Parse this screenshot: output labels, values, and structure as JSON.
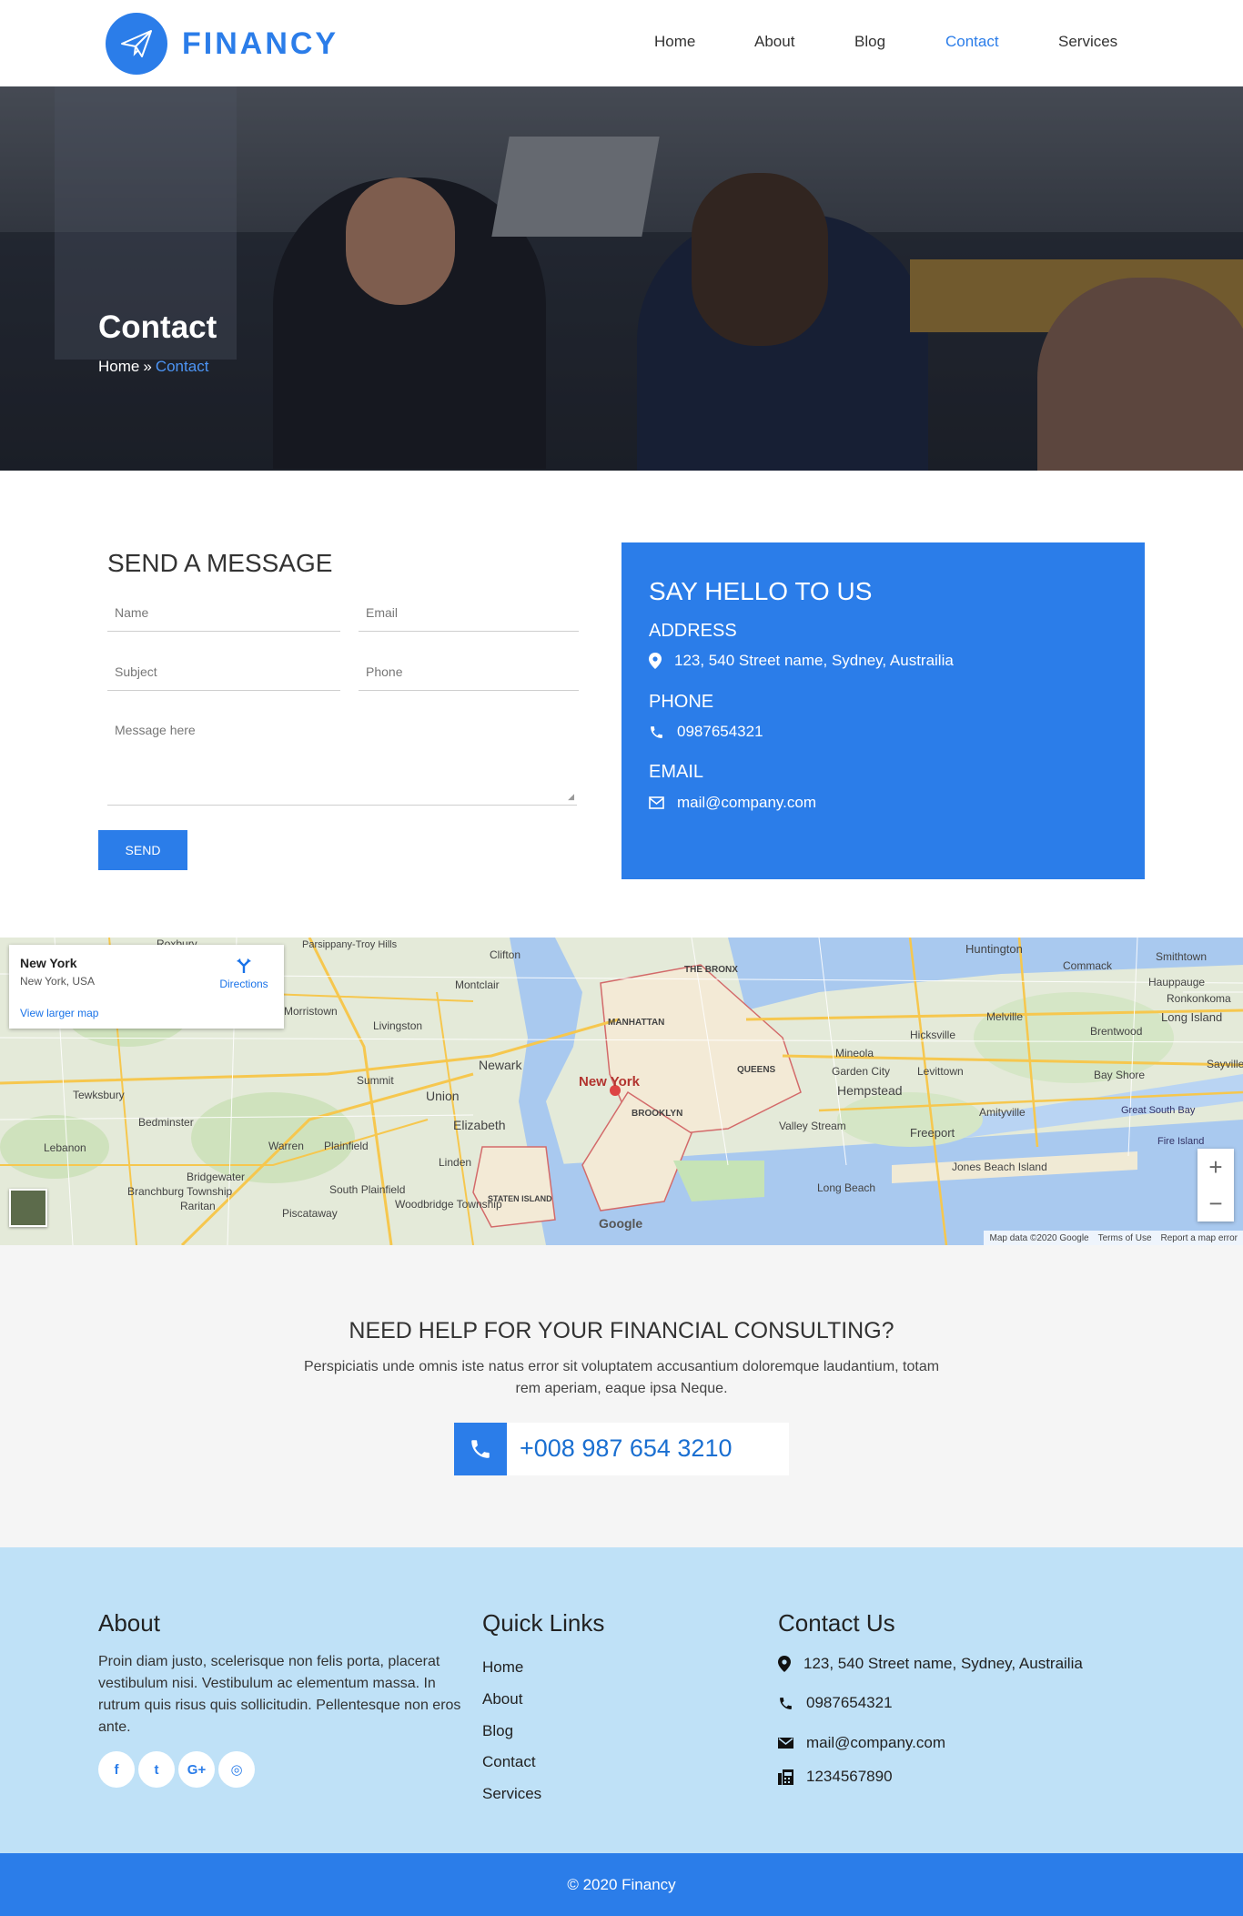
{
  "header": {
    "brand": "FINANCY",
    "nav": [
      {
        "label": "Home"
      },
      {
        "label": "About"
      },
      {
        "label": "Blog"
      },
      {
        "label": "Contact",
        "active": true
      },
      {
        "label": "Services"
      }
    ]
  },
  "hero": {
    "title": "Contact",
    "breadcrumb": {
      "home": "Home",
      "separator": "»",
      "current": "Contact"
    }
  },
  "form": {
    "title": "SEND A MESSAGE",
    "name_placeholder": "Name",
    "email_placeholder": "Email",
    "subject_placeholder": "Subject",
    "phone_placeholder": "Phone",
    "message_placeholder": "Message here",
    "submit_label": "SEND"
  },
  "hello": {
    "title": "SAY HELLO TO US",
    "address_label": "ADDRESS",
    "address": "123, 540 Street name, Sydney, Austrailia",
    "phone_label": "PHONE",
    "phone": "0987654321",
    "email_label": "EMAIL",
    "email": "mail@company.com"
  },
  "map": {
    "place_name": "New York",
    "place_sub": "New York, USA",
    "directions": "Directions",
    "larger_map": "View larger map",
    "city_label": "New York",
    "labels": [
      "Clifton",
      "Newark",
      "Elizabeth",
      "Union",
      "BROOKLYN",
      "QUEENS",
      "MANHATTAN",
      "THE BRONX",
      "Huntington",
      "Long Island",
      "Hempstead",
      "Freeport",
      "Long Beach",
      "Jones Beach Island",
      "Valley Stream",
      "Mineola",
      "Garden City",
      "Levittown",
      "Hicksville",
      "Melville",
      "Bay Shore",
      "Brentwood",
      "Amityville",
      "Fire Island",
      "Great South Bay",
      "Summit",
      "Livingston",
      "Montclair",
      "Tewksbury",
      "Bedminster",
      "Warren",
      "Plainfield",
      "Bridgewater",
      "Woodbridge Township",
      "South Plainfield",
      "Piscataway",
      "Linden",
      "STATEN ISLAND",
      "Parsippany-Troy Hills",
      "Commack",
      "Smithtown",
      "Hauppauge",
      "Ronkonkoma",
      "Sayville",
      "Branchburg Township",
      "Raritan",
      "Lebanon",
      "Roxbury",
      "Morristown"
    ],
    "footer": [
      "Map data ©2020 Google",
      "Terms of Use",
      "Report a map error"
    ],
    "zoom_in": "+",
    "zoom_out": "−",
    "brand": "Google"
  },
  "help": {
    "title": "NEED HELP FOR YOUR FINANCIAL CONSULTING?",
    "text": "Perspiciatis unde omnis iste natus error sit voluptatem accusantium doloremque laudantium, totam rem aperiam, eaque ipsa Neque.",
    "phone": "+008 987 654 3210"
  },
  "footer": {
    "about_title": "About",
    "about_text": "Proin diam justo, scelerisque non felis porta, placerat vestibulum nisi. Vestibulum ac elementum massa. In rutrum quis risus quis sollicitudin. Pellentesque non eros ante.",
    "social": [
      {
        "icon": "facebook-icon",
        "glyph": "f"
      },
      {
        "icon": "twitter-icon",
        "glyph": "t"
      },
      {
        "icon": "google-plus-icon",
        "glyph": "G+"
      },
      {
        "icon": "instagram-icon",
        "glyph": "◎"
      }
    ],
    "links_title": "Quick Links",
    "links": [
      "Home",
      "About",
      "Blog",
      "Contact",
      "Services"
    ],
    "contact_title": "Contact Us",
    "address": "123, 540 Street name, Sydney, Austrailia",
    "phone": "0987654321",
    "email": "mail@company.com",
    "fax": "1234567890",
    "copyright": "© 2020 Financy"
  },
  "colors": {
    "accent": "#2b7de9",
    "footer_bg": "#bfe1f7",
    "help_bg": "#f5f5f5"
  }
}
